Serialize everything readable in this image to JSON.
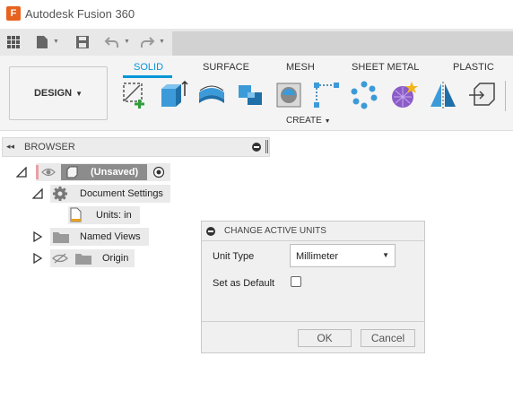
{
  "app": {
    "title": "Autodesk Fusion 360",
    "logo_letter": "F"
  },
  "workspace": {
    "label": "DESIGN"
  },
  "ribbon": {
    "tabs": [
      "SOLID",
      "SURFACE",
      "MESH",
      "SHEET METAL",
      "PLASTIC"
    ],
    "active_tab": "SOLID",
    "group_label": "CREATE",
    "tools": [
      "create-sketch-icon",
      "extrude-icon",
      "revolve-icon",
      "sweep-icon",
      "hole-icon",
      "rectangular-pattern-icon",
      "circular-pattern-icon",
      "form-icon",
      "mirror-icon",
      "derive-icon"
    ]
  },
  "browser": {
    "title": "BROWSER",
    "root": {
      "label": "(Unsaved)"
    },
    "nodes": {
      "document_settings": "Document Settings",
      "units": "Units: in",
      "named_views": "Named Views",
      "origin": "Origin"
    }
  },
  "dialog": {
    "title": "CHANGE ACTIVE UNITS",
    "unit_type_label": "Unit Type",
    "unit_type_value": "Millimeter",
    "set_default_label": "Set as Default",
    "set_default_checked": false,
    "ok_label": "OK",
    "cancel_label": "Cancel"
  },
  "colors": {
    "accent": "#0696d7",
    "logo": "#e8621f",
    "unsaved_node": "#8c8c8c"
  }
}
